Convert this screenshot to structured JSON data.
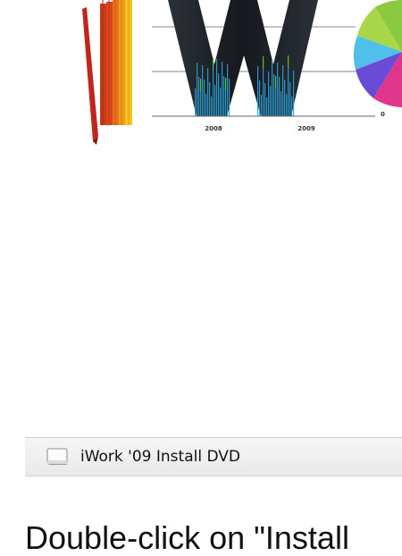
{
  "artwork": {
    "year_labels": [
      "2008",
      "2009"
    ],
    "axis_zero_label": "0",
    "colors": {
      "letter_dark": "#1f242b",
      "bar_blue": "#2aa3d8",
      "bar_green": "#5bbf2e",
      "pencils": [
        "#c0261c",
        "#d9461a",
        "#e8731a",
        "#f09a1c",
        "#f6c21e"
      ],
      "pie": [
        "#8ac940",
        "#4fc0e9",
        "#6a4bd6",
        "#e0358a"
      ]
    },
    "icons": [
      "pencils-icon",
      "chart-letter-w-icon",
      "pie-chart-icon"
    ]
  },
  "volume": {
    "icon": "disk-icon",
    "name": "iWork '09 Install DVD"
  },
  "instruction": {
    "text": "Double-click on \"Install"
  }
}
